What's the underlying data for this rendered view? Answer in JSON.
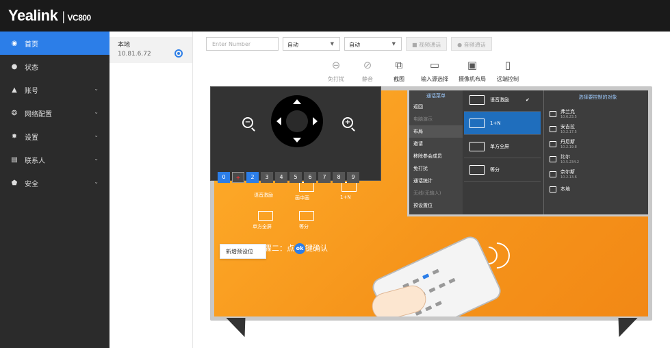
{
  "header": {
    "brand": "Yealink",
    "separator": "|",
    "model": "VC800"
  },
  "sidebar": {
    "items": [
      {
        "label": "首页",
        "icon": "home-icon",
        "active": true,
        "has_chevron": false
      },
      {
        "label": "状态",
        "icon": "info-icon",
        "active": false,
        "has_chevron": false
      },
      {
        "label": "账号",
        "icon": "user-icon",
        "active": false,
        "has_chevron": true
      },
      {
        "label": "网络配置",
        "icon": "network-icon",
        "active": false,
        "has_chevron": true
      },
      {
        "label": "设置",
        "icon": "gear-icon",
        "active": false,
        "has_chevron": true
      },
      {
        "label": "联系人",
        "icon": "contacts-icon",
        "active": false,
        "has_chevron": true
      },
      {
        "label": "安全",
        "icon": "shield-icon",
        "active": false,
        "has_chevron": true
      }
    ]
  },
  "device": {
    "name": "本地",
    "ip": "10.81.6.72"
  },
  "toolbar": {
    "number_placeholder": "Enter Number",
    "select1": "自动",
    "select2": "自动",
    "video_call": "视频通话",
    "audio_call": "音频通话"
  },
  "controls": [
    {
      "label": "免打扰",
      "icon": "dnd-icon",
      "enabled": false
    },
    {
      "label": "静音",
      "icon": "mute-icon",
      "enabled": false
    },
    {
      "label": "截图",
      "icon": "screenshot-icon",
      "enabled": true
    },
    {
      "label": "输入源选择",
      "icon": "input-source-icon",
      "enabled": true
    },
    {
      "label": "摄像机布局",
      "icon": "camera-layout-icon",
      "enabled": true
    },
    {
      "label": "远端控制",
      "icon": "remote-control-icon",
      "enabled": true
    }
  ],
  "camera": {
    "presets": [
      "0",
      "+",
      "2",
      "3",
      "4",
      "5",
      "6",
      "7",
      "8",
      "9"
    ],
    "tooltip": "新增预设位"
  },
  "illustration": {
    "menu_head": "通话菜单",
    "menu_items": [
      "返回",
      "布局",
      "邀请",
      "移除参会成员",
      "免打扰",
      "通话统计",
      "预设置位"
    ],
    "menu_dim_items": [
      "电脑演示",
      "无线(无输入)"
    ],
    "layouts": [
      "语音激励",
      "1+N",
      "单方全屏",
      "等分"
    ],
    "target_head": "选择要控制的对象",
    "targets": [
      {
        "name": "弗兰克",
        "ip": "10.6.23.5"
      },
      {
        "name": "安吉拉",
        "ip": "10.2.17.5"
      },
      {
        "name": "丹尼斯",
        "ip": "10.2.19.8"
      },
      {
        "name": "比尔",
        "ip": "10.5.234.2"
      },
      {
        "name": "奈尔斯",
        "ip": "10.2.13.6"
      },
      {
        "name": "本地",
        "ip": ""
      }
    ],
    "bg_labels": [
      "语音激励",
      "画中画",
      "1+N",
      "单方全屏",
      "等分"
    ],
    "step2_prefix": "步骤二：点",
    "step2_ok": "ok",
    "step2_suffix": "键确认"
  }
}
